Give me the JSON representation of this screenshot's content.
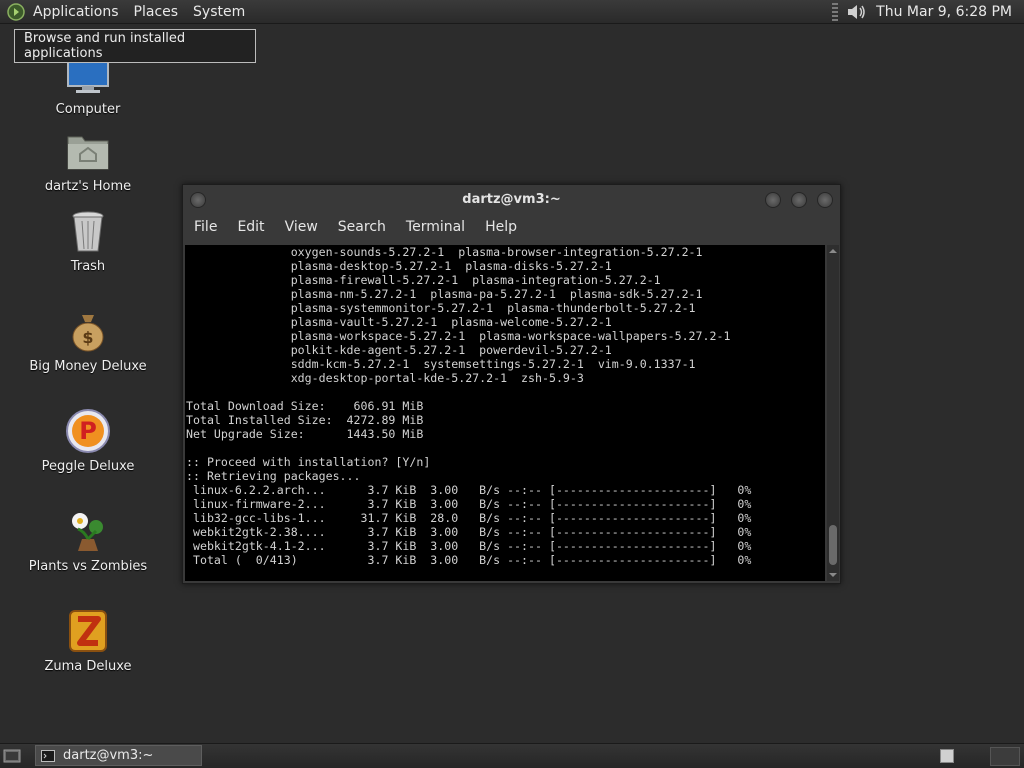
{
  "top_panel": {
    "menus": [
      "Applications",
      "Places",
      "System"
    ],
    "clock": "Thu Mar  9,  6:28 PM"
  },
  "tooltip": "Browse and run installed applications",
  "desktop_icons": [
    {
      "label": "Computer",
      "icon": "computer-icon"
    },
    {
      "label": "dartz's Home",
      "icon": "home-folder-icon"
    },
    {
      "label": "Trash",
      "icon": "trash-icon"
    },
    {
      "label": "Big Money Deluxe",
      "icon": "money-bag-icon"
    },
    {
      "label": "Peggle Deluxe",
      "icon": "peggle-icon"
    },
    {
      "label": "Plants vs Zombies",
      "icon": "plants-vs-zombies-icon"
    },
    {
      "label": "Zuma Deluxe",
      "icon": "zuma-icon"
    }
  ],
  "terminal": {
    "title": "dartz@vm3:~",
    "menu": [
      "File",
      "Edit",
      "View",
      "Search",
      "Terminal",
      "Help"
    ],
    "output": "               oxygen-sounds-5.27.2-1  plasma-browser-integration-5.27.2-1\n               plasma-desktop-5.27.2-1  plasma-disks-5.27.2-1\n               plasma-firewall-5.27.2-1  plasma-integration-5.27.2-1\n               plasma-nm-5.27.2-1  plasma-pa-5.27.2-1  plasma-sdk-5.27.2-1\n               plasma-systemmonitor-5.27.2-1  plasma-thunderbolt-5.27.2-1\n               plasma-vault-5.27.2-1  plasma-welcome-5.27.2-1\n               plasma-workspace-5.27.2-1  plasma-workspace-wallpapers-5.27.2-1\n               polkit-kde-agent-5.27.2-1  powerdevil-5.27.2-1\n               sddm-kcm-5.27.2-1  systemsettings-5.27.2-1  vim-9.0.1337-1\n               xdg-desktop-portal-kde-5.27.2-1  zsh-5.9-3\n\nTotal Download Size:    606.91 MiB\nTotal Installed Size:  4272.89 MiB\nNet Upgrade Size:      1443.50 MiB\n\n:: Proceed with installation? [Y/n]\n:: Retrieving packages...\n linux-6.2.2.arch...      3.7 KiB  3.00   B/s --:-- [----------------------]   0%\n linux-firmware-2...      3.7 KiB  3.00   B/s --:-- [----------------------]   0%\n lib32-gcc-libs-1...     31.7 KiB  28.0   B/s --:-- [----------------------]   0%\n webkit2gtk-2.38....      3.7 KiB  3.00   B/s --:-- [----------------------]   0%\n webkit2gtk-4.1-2...      3.7 KiB  3.00   B/s --:-- [----------------------]   0%\n Total (  0/413)          3.7 KiB  3.00   B/s --:-- [----------------------]   0%"
  },
  "taskbar": {
    "task_label": "dartz@vm3:~"
  },
  "colors": {
    "desktop_bg": "#2c2c2c",
    "terminal_bg": "#000000",
    "terminal_fg": "#d2d2d2",
    "panel_bg": "#2e2e2e"
  }
}
